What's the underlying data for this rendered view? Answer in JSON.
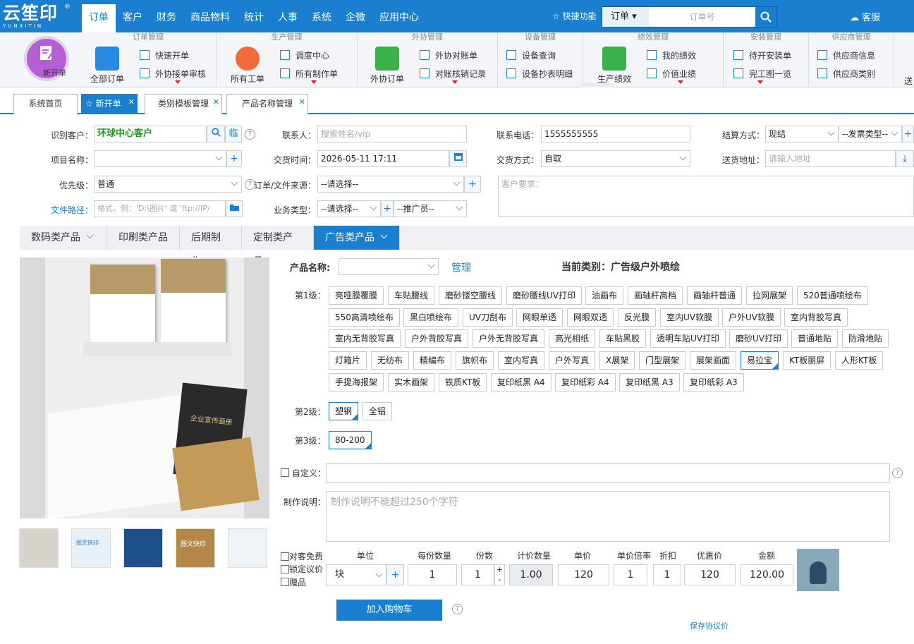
{
  "app": {
    "logo_text": "云笙印",
    "logo_sub": "YUNXITIN",
    "logo_mark": "®"
  },
  "topnav": [
    {
      "label": "订单",
      "active": true
    },
    {
      "label": "客户"
    },
    {
      "label": "财务"
    },
    {
      "label": "商品物料"
    },
    {
      "label": "统计"
    },
    {
      "label": "人事"
    },
    {
      "label": "系统"
    },
    {
      "label": "企微"
    },
    {
      "label": "应用中心"
    }
  ],
  "header": {
    "quick": "快捷功能",
    "search_type": "订单",
    "search_placeholder": "订单号",
    "service": "客服"
  },
  "ribbon": {
    "new_order": "新开单",
    "groups": [
      {
        "title": "订单管理",
        "big": "全部订单",
        "items": [
          "快速开单",
          "外协接单审核"
        ]
      },
      {
        "title": "生产管理",
        "big": "所有工单",
        "items": [
          "调度中心",
          "所有制作单"
        ]
      },
      {
        "title": "外协管理",
        "big": "外协订单",
        "items": [
          "外协对账单",
          "对账核销记录"
        ]
      },
      {
        "title": "设备管理",
        "items": [
          "设备查询",
          "设备抄表明细"
        ]
      },
      {
        "title": "绩效管理",
        "big": "生产绩效",
        "items": [
          "我的绩效",
          "价值业绩"
        ]
      },
      {
        "title": "安装管理",
        "items": [
          "待开安装单",
          "完工图一览"
        ]
      },
      {
        "title": "供应商管理",
        "items": [
          "供应商信息",
          "供应商类别"
        ]
      }
    ],
    "overflow": "送"
  },
  "tabs": [
    {
      "label": "系统首页"
    },
    {
      "label": "新开单",
      "active": true
    },
    {
      "label": "类别模板管理"
    },
    {
      "label": "产品名称管理"
    }
  ],
  "form": {
    "customer_label": "识别客户：",
    "customer_value": "环球中心客户",
    "temp_btn": "临",
    "contact_label": "联系人：",
    "contact_placeholder": "搜索姓名/vip",
    "phone_label": "联系电话：",
    "phone_value": "1555555555",
    "settle_label": "结算方式：",
    "settle_value": "现结",
    "invoice_value": "--发票类型--",
    "project_label": "项目名称：",
    "delivery_time_label": "交货时间：",
    "delivery_time_value": "2026-05-11 17:11",
    "delivery_mode_label": "交货方式：",
    "delivery_mode_value": "自取",
    "address_label": "送货地址：",
    "address_placeholder": "请输入地址",
    "priority_label": "优先级：",
    "priority_value": "普通",
    "source_label": "订单/文件来源：",
    "source_value": "--请选择--",
    "file_label": "文件路径：",
    "file_placeholder": "格式，例：'D:\\图片' 或 'ftp://IP/",
    "biz_label": "业务类型：",
    "biz_value": "--请选择--",
    "promoter_value": "--推广员--",
    "req_placeholder": "客户要求："
  },
  "category_tabs": [
    {
      "label": "数码类产品",
      "chev": true
    },
    {
      "label": "印刷类产品"
    },
    {
      "label": "后期制作"
    },
    {
      "label": "定制类产品"
    },
    {
      "label": "广告类产品",
      "active": true,
      "chev": true
    }
  ],
  "product": {
    "name_label": "产品名称:",
    "manage": "管理",
    "current": "当前类别：广告级户外喷绘",
    "level1_label": "第1级：",
    "level2_label": "第2级：",
    "level3_label": "第3级：",
    "level1": [
      "亮哑膜覆膜",
      "车贴腰线",
      "磨砂镂空腰线",
      "磨砂腰线UV打印",
      "油画布",
      "画轴杆高档",
      "画轴杆普通",
      "拉网展架",
      "520普通喷绘布",
      "550高清喷绘布",
      "黑白喷绘布",
      "UV刀刮布",
      "网眼单透",
      "网眼双透",
      "反光膜",
      "室内UV软膜",
      "户外UV软膜",
      "室内背胶写真",
      "室内无背胶写真",
      "户外背胶写真",
      "户外无背胶写真",
      "高光相纸",
      "车贴黑胶",
      "透明车贴UV打印",
      "磨砂UV打印",
      "普通地贴",
      "防滑地贴",
      "灯箱片",
      "无纺布",
      "精编布",
      "旗帜布",
      "室内写真",
      "户外写真",
      "X展架",
      "门型展架",
      "展架画面",
      "易拉宝",
      "KT板丽屏",
      "人形KT板",
      "手提海报架",
      "实木画架",
      "铁质KT板",
      "复印纸黑 A4",
      "复印纸彩 A4",
      "复印纸黑 A3",
      "复印纸彩 A3"
    ],
    "level1_selected": "易拉宝",
    "level2": [
      "塑钢",
      "全铝"
    ],
    "level2_selected": "塑钢",
    "level3": [
      "80-200"
    ],
    "level3_selected": "80-200",
    "custom_label": "自定义：",
    "note_label": "制作说明：",
    "note_placeholder": "制作说明不能超过250个字符"
  },
  "pricing": {
    "checks": [
      "对客免费",
      "锁定议价",
      "赠品"
    ],
    "headers": [
      "单位",
      "每份数量",
      "份数",
      "计价数量",
      "单价",
      "单价倍率",
      "折扣",
      "优惠价",
      "金额"
    ],
    "unit": "块",
    "qty": "1",
    "copies": "1",
    "calc_qty": "1.00",
    "unit_price": "120",
    "rate": "1",
    "discount": "1",
    "promo": "120",
    "amount": "120.00",
    "cart": "加入购物车",
    "save_price": "保存协议价"
  },
  "gallery": {
    "cover_title": "企业宣传画册",
    "thumb_texts": [
      "图文快印",
      "图文快印"
    ]
  },
  "colors": {
    "primary": "#1b7fd0",
    "green": "#1a9a1a",
    "red": "#e02020"
  }
}
